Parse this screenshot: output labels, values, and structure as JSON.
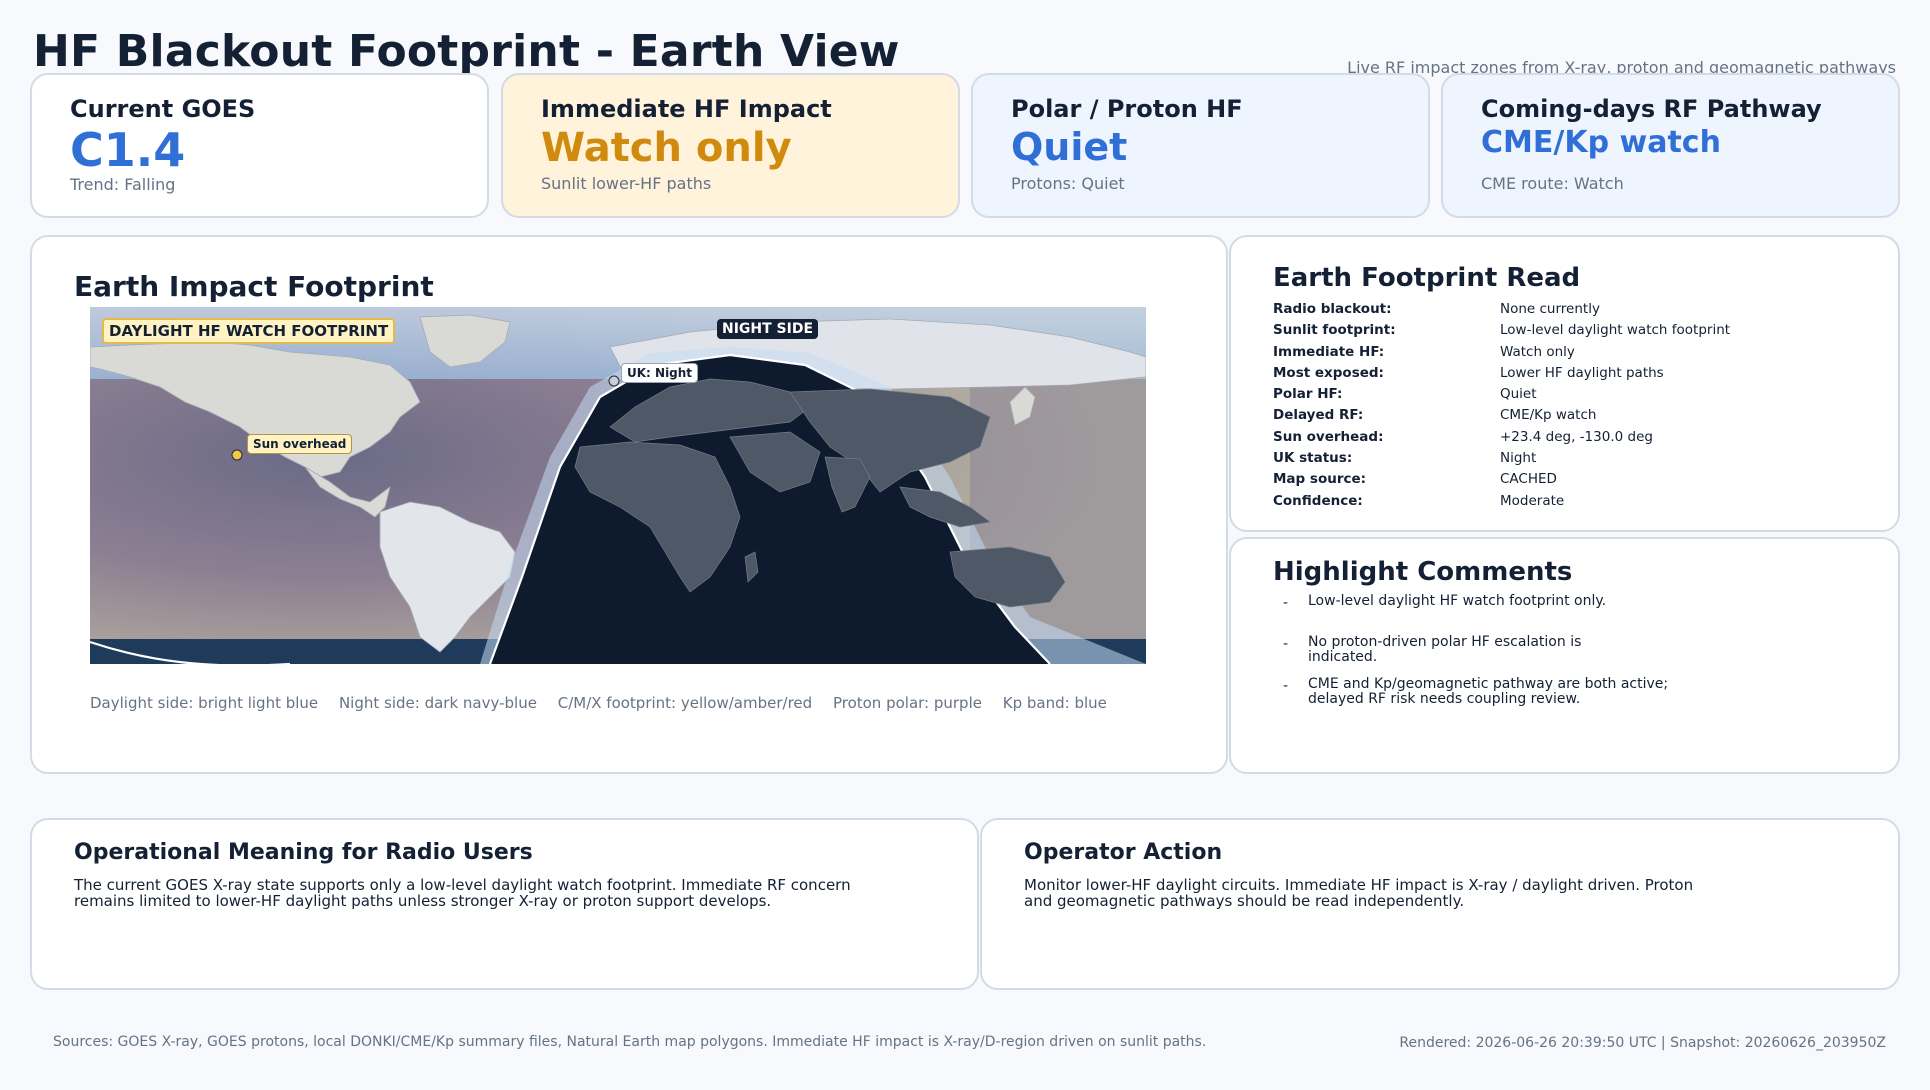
{
  "header": {
    "title": "HF Blackout Footprint - Earth View",
    "subtitle": "Live RF impact zones from X-ray, proton and geomagnetic pathways"
  },
  "kpis": [
    {
      "label": "Current GOES",
      "value": "C1.4",
      "sub": "Trend: Falling",
      "value_color": "#2f6fd6",
      "bg": "#ffffff"
    },
    {
      "label": "Immediate HF Impact",
      "value": "Watch only",
      "sub": "Sunlit lower-HF paths",
      "value_color": "#d08a0e",
      "bg": "#fff3dc"
    },
    {
      "label": "Polar / Proton HF",
      "value": "Quiet",
      "sub": "Protons: Quiet",
      "value_color": "#2f6fd6",
      "bg": "#eef5fe"
    },
    {
      "label": "Coming-days RF Pathway",
      "value": "CME/Kp watch",
      "sub": "CME route: Watch",
      "value_color": "#2f6fd6",
      "bg": "#eef5fe"
    }
  ],
  "map_panel": {
    "title": "Earth Impact Footprint",
    "tags": {
      "daylight": "DAYLIGHT HF WATCH FOOTPRINT",
      "night": "NIGHT SIDE",
      "uk": "UK: Night",
      "sun": "Sun overhead"
    },
    "legend": [
      "Daylight side: bright light blue",
      "Night side: dark navy-blue",
      "C/M/X footprint: yellow/amber/red",
      "Proton polar: purple",
      "Kp band: blue"
    ]
  },
  "footprint_read": {
    "title": "Earth Footprint Read",
    "rows": [
      {
        "key": "Radio blackout:",
        "value": "None currently"
      },
      {
        "key": "Sunlit footprint:",
        "value": "Low-level daylight watch footprint"
      },
      {
        "key": "Immediate HF:",
        "value": "Watch only"
      },
      {
        "key": "Most exposed:",
        "value": "Lower HF daylight paths"
      },
      {
        "key": "Polar HF:",
        "value": "Quiet"
      },
      {
        "key": "Delayed RF:",
        "value": "CME/Kp watch"
      },
      {
        "key": "Sun overhead:",
        "value": "+23.4 deg, -130.0 deg"
      },
      {
        "key": "UK status:",
        "value": "Night"
      },
      {
        "key": "Map source:",
        "value": "CACHED"
      },
      {
        "key": "Confidence:",
        "value": "Moderate"
      }
    ]
  },
  "highlights": {
    "title": "Highlight Comments",
    "items": [
      {
        "dash": "-",
        "text": "Low-level daylight HF watch footprint only."
      },
      {
        "dash": "-",
        "text": "No proton-driven polar HF escalation is indicated."
      },
      {
        "dash": "-",
        "text": "CME and Kp/geomagnetic pathway are both active; delayed RF risk needs coupling review."
      }
    ]
  },
  "operational": {
    "title": "Operational Meaning for Radio Users",
    "text": "The current GOES X-ray state supports only a low-level daylight watch footprint. Immediate RF concern remains limited to lower-HF daylight paths unless stronger X-ray or proton support develops."
  },
  "action": {
    "title": "Operator Action",
    "text": "Monitor lower-HF daylight circuits. Immediate HF impact is X-ray / daylight driven. Proton and geomagnetic pathways should be read independently."
  },
  "footer": {
    "sources": "Sources: GOES X-ray, GOES protons, local DONKI/CME/Kp summary files, Natural Earth map polygons. Immediate HF impact is X-ray/D-region driven on sunlit paths.",
    "rendered": "Rendered: 2026-06-26 20:39:50 UTC  |  Snapshot: 20260626_203950Z"
  }
}
